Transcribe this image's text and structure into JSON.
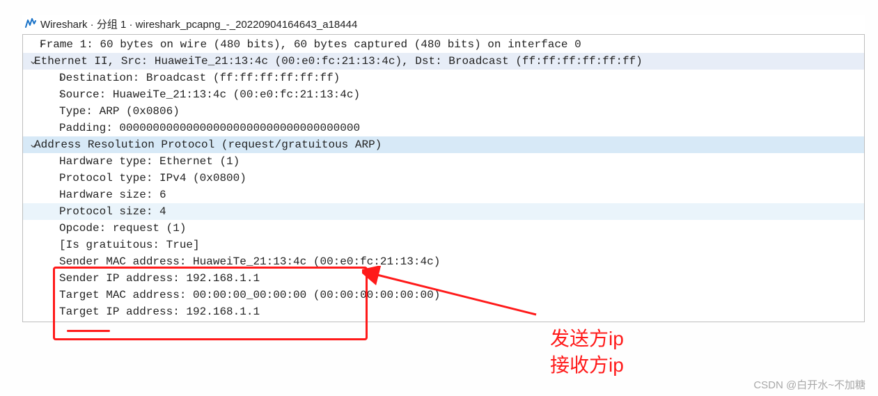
{
  "title": "Wireshark · 分组 1 · wireshark_pcapng_-_20220904164643_a18444",
  "rows": {
    "frame": "Frame 1: 60 bytes on wire (480 bits), 60 bytes captured (480 bits) on interface 0",
    "eth": "Ethernet II, Src: HuaweiTe_21:13:4c (00:e0:fc:21:13:4c), Dst: Broadcast (ff:ff:ff:ff:ff:ff)",
    "eth_dst": "Destination: Broadcast (ff:ff:ff:ff:ff:ff)",
    "eth_src": "Source: HuaweiTe_21:13:4c (00:e0:fc:21:13:4c)",
    "eth_type": "Type: ARP (0x0806)",
    "eth_pad": "Padding: 000000000000000000000000000000000000",
    "arp": "Address Resolution Protocol (request/gratuitous ARP)",
    "arp_hwtype": "Hardware type: Ethernet (1)",
    "arp_ptype": "Protocol type: IPv4 (0x0800)",
    "arp_hwsize": "Hardware size: 6",
    "arp_psize": "Protocol size: 4",
    "arp_opcode": "Opcode: request (1)",
    "arp_grat": "[Is gratuitous: True]",
    "arp_smac": "Sender MAC address: HuaweiTe_21:13:4c (00:e0:fc:21:13:4c)",
    "arp_sip": "Sender IP address: 192.168.1.1",
    "arp_tmac": "Target MAC address: 00:00:00_00:00:00 (00:00:00:00:00:00)",
    "arp_tip": "Target IP address: 192.168.1.1"
  },
  "toggles": {
    "collapsed": "›",
    "expanded": "⌄"
  },
  "annotations": {
    "sender_label": "发送方ip",
    "receiver_label": "接收方ip"
  },
  "watermark": "CSDN @白开水~不加糖"
}
